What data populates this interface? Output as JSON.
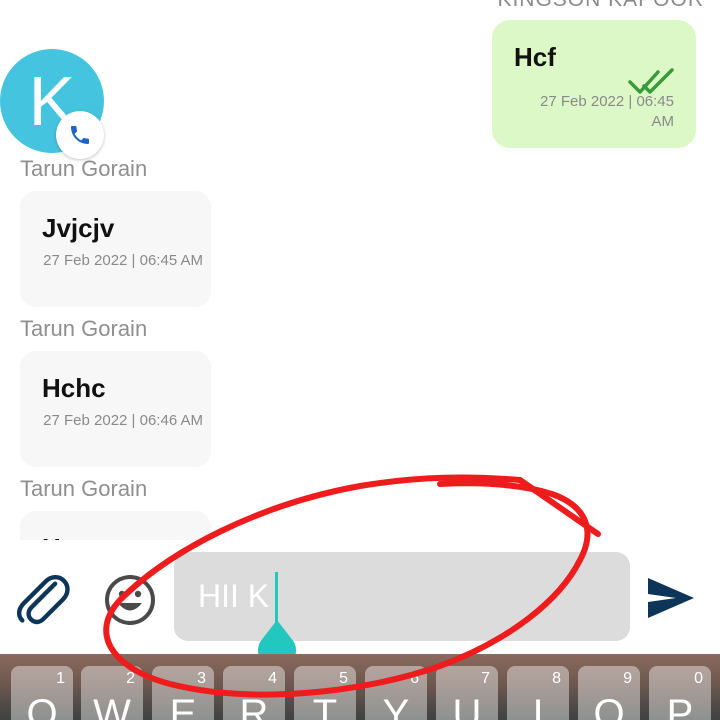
{
  "outgoing": {
    "sender": "KINGSON KAPOOR",
    "text": "Hcf",
    "time": "27 Feb 2022 | 06:45 AM"
  },
  "contact": {
    "initial": "K",
    "avatar_color": "#45c4df"
  },
  "incoming": [
    {
      "sender": "Tarun Gorain",
      "text": "Jvjcjv",
      "time": "27 Feb 2022 | 06:45 AM"
    },
    {
      "sender": "Tarun Gorain",
      "text": "Hchc",
      "time": "27 Feb 2022 | 06:46 AM"
    },
    {
      "sender": "Tarun Gorain",
      "text": "H"
    }
  ],
  "composer": {
    "input_value": "HII K",
    "attach_icon": "paperclip-icon",
    "emoji_icon": "smiley-icon",
    "send_icon": "send-icon",
    "caret_color": "#22c7bd"
  },
  "keyboard": {
    "keys": [
      {
        "label": "Q",
        "hint": "1"
      },
      {
        "label": "W",
        "hint": "2"
      },
      {
        "label": "E",
        "hint": "3"
      },
      {
        "label": "R",
        "hint": "4"
      },
      {
        "label": "T",
        "hint": "5"
      },
      {
        "label": "Y",
        "hint": "6"
      },
      {
        "label": "U",
        "hint": "7"
      },
      {
        "label": "I",
        "hint": "8"
      },
      {
        "label": "O",
        "hint": "9"
      },
      {
        "label": "P",
        "hint": "0"
      }
    ]
  },
  "colors": {
    "outgoing_bubble": "#dcf8c6",
    "incoming_bubble": "#f7f7f7",
    "read_ticks": "#3a9a3a",
    "send_icon": "#0d3557",
    "annotation": "#ee1c1c"
  }
}
